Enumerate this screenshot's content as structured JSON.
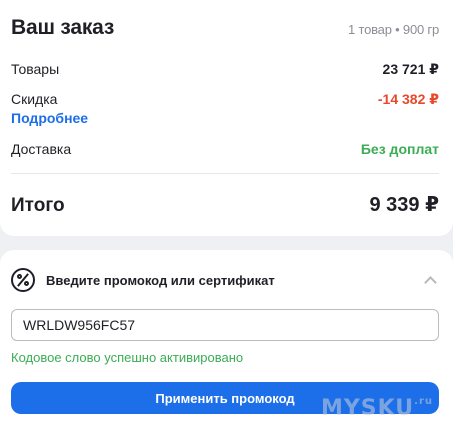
{
  "order": {
    "title": "Ваш заказ",
    "meta": "1 товар • 900 гр",
    "rows": [
      {
        "label": "Товары",
        "value": "23 721 ₽"
      },
      {
        "label": "Скидка",
        "value": "-14 382 ₽",
        "link": "Подробнее"
      },
      {
        "label": "Доставка",
        "value": "Без доплат"
      }
    ],
    "total_label": "Итого",
    "total_value": "9 339 ₽"
  },
  "promo": {
    "title": "Введите промокод или сертификат",
    "icon": "discount-percent-icon",
    "code": "WRLDW956FC57",
    "success": "Кодовое слово успешно активировано",
    "apply_label": "Применить промокод"
  },
  "watermark": {
    "text": "MYSKU",
    "suffix": ".ru"
  },
  "colors": {
    "accent": "#1c6fe8",
    "discount": "#e8482c",
    "success": "#3aad55"
  }
}
